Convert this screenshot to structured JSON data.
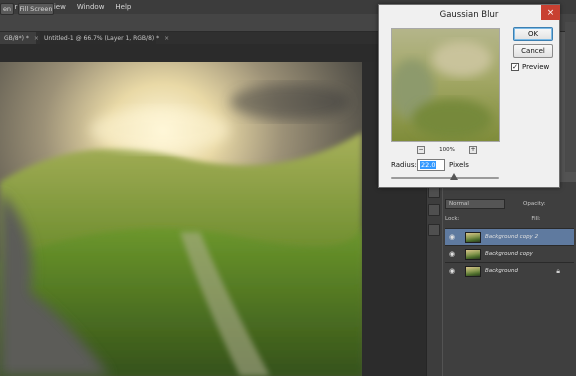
{
  "menu": {
    "items": [
      "Filter",
      "3D",
      "View",
      "Window",
      "Help"
    ]
  },
  "options": {
    "btn1": "en",
    "btn2": "Fill Screen"
  },
  "tabs": [
    {
      "label": "GB/8*) *",
      "close": "×"
    },
    {
      "label": "Untitled-1 @ 66.7% (Layer 1, RGB/8) *",
      "close": "×"
    }
  ],
  "dialog": {
    "title": "Gaussian Blur",
    "close": "×",
    "ok_label": "OK",
    "cancel_label": "Cancel",
    "preview_label": "Preview",
    "preview_checked": true,
    "check_mark": "✓",
    "zoom_out": "−",
    "zoom_in": "+",
    "zoom_level": "100%",
    "radius_label": "Radius:",
    "radius_value": "22.0",
    "radius_unit": "Pixels",
    "slider_fraction": 0.58
  },
  "layers_panel": {
    "blend_mode": "Normal",
    "opacity_label": "Opacity:",
    "lock_label": "Lock:",
    "fill_label": "Fill:",
    "layers": [
      {
        "name": "Background copy 2",
        "selected": true,
        "locked": false
      },
      {
        "name": "Background copy",
        "selected": false,
        "locked": false
      },
      {
        "name": "Background",
        "selected": false,
        "locked": true
      }
    ]
  },
  "colors": {
    "accent_selected_layer": "#5f7a9f",
    "dialog_close": "#c84031"
  }
}
